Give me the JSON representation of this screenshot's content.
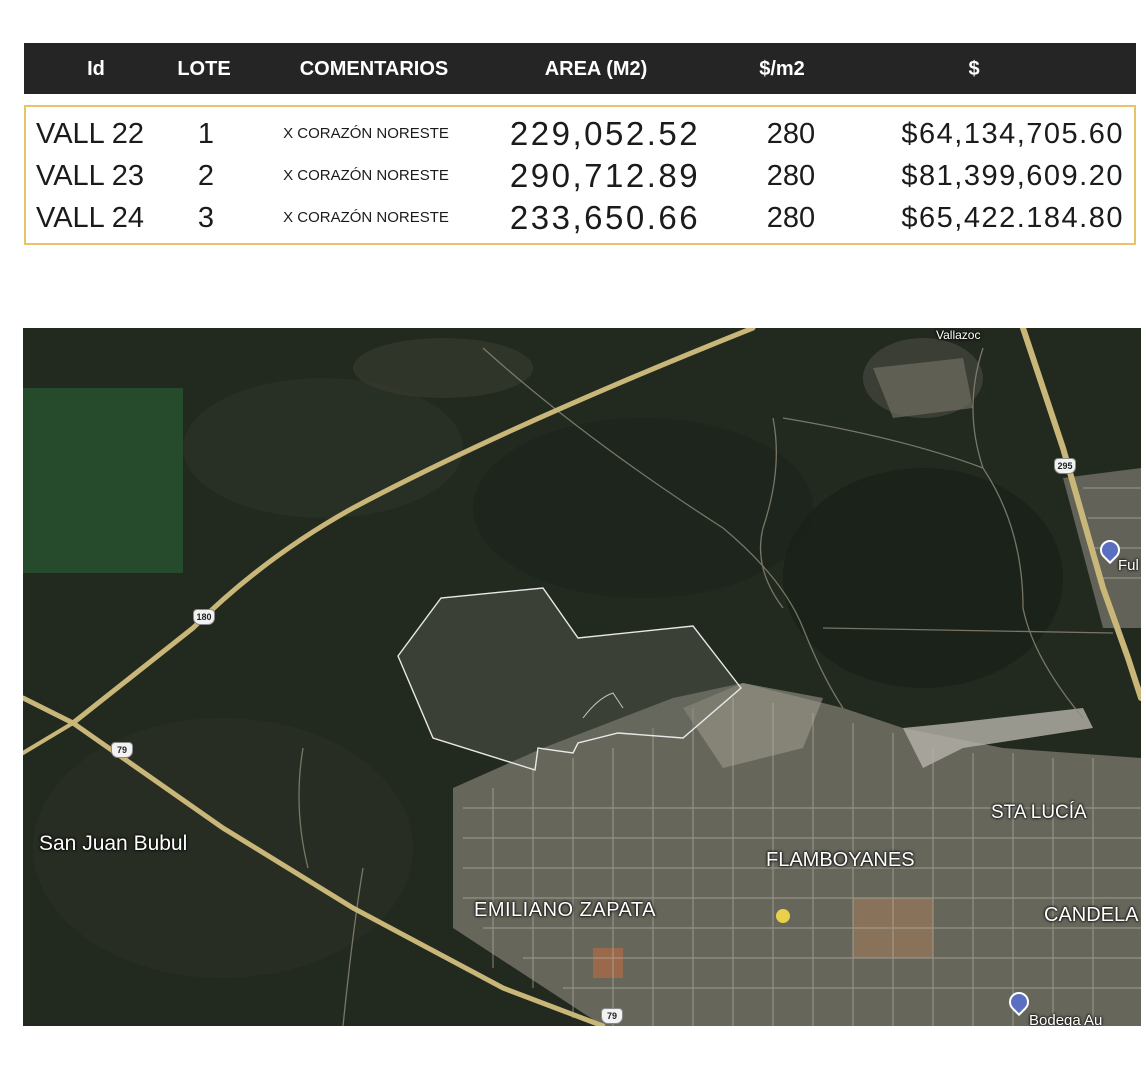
{
  "table": {
    "headers": {
      "id": "Id",
      "lote": "LOTE",
      "comentarios": "COMENTARIOS",
      "area": "AREA (M2)",
      "precio_m2": "$/m2",
      "total": "$"
    },
    "rows": [
      {
        "id": "VALL 22",
        "lote": "1",
        "comentarios": "X CORAZÓN NORESTE",
        "area": "229,052.52",
        "precio_m2": "280",
        "total": "$64,134,705.60"
      },
      {
        "id": "VALL 23",
        "lote": "2",
        "comentarios": "X CORAZÓN NORESTE",
        "area": "290,712.89",
        "precio_m2": "280",
        "total": "$81,399,609.20"
      },
      {
        "id": "VALL 24",
        "lote": "3",
        "comentarios": "X CORAZÓN NORESTE",
        "area": "233,650.66",
        "precio_m2": "280",
        "total": "$65,422.184.80"
      }
    ],
    "colors": {
      "header_bg": "#252525",
      "header_text": "#ffffff",
      "border": "#e8c36a"
    }
  },
  "map": {
    "labels": {
      "san_juan_bubul": "San Juan Bubul",
      "emiliano_zapata": "EMILIANO ZAPATA",
      "flamboyanes": "FLAMBOYANES",
      "sta_lucia": "STA LUCÍA",
      "candela": "CANDELA",
      "vallazoc": "Vallazoc",
      "ful": "Ful",
      "bodega": "Bodega Au"
    },
    "highways": {
      "h180": "180",
      "h79a": "79",
      "h79b": "79",
      "h295": "295"
    },
    "pin_icons": [
      "map-pin-icon",
      "map-pin-icon"
    ],
    "colors": {
      "vegetation": "#22291f",
      "urban": "#8c8a7f",
      "road": "#c9b679",
      "parcel_outline": "#e8e8e8"
    }
  }
}
